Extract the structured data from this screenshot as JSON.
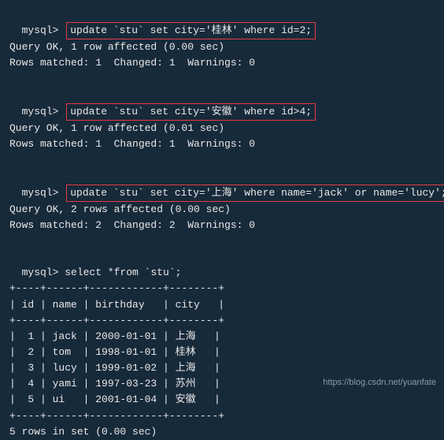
{
  "commands": [
    {
      "prompt": "mysql>",
      "sql": "update `stu` set city='桂林' where id=2;",
      "resultLine": "Query OK, 1 row affected (0.00 sec)",
      "matchLine": "Rows matched: 1  Changed: 1  Warnings: 0"
    },
    {
      "prompt": "mysql>",
      "sql": "update `stu` set city='安徽' where id>4;",
      "resultLine": "Query OK, 1 row affected (0.01 sec)",
      "matchLine": "Rows matched: 1  Changed: 1  Warnings: 0"
    },
    {
      "prompt": "mysql>",
      "sql": "update `stu` set city='上海' where name='jack' or name='lucy';",
      "resultLine": "Query OK, 2 rows affected (0.00 sec)",
      "matchLine": "Rows matched: 2  Changed: 2  Warnings: 0"
    }
  ],
  "selectPrompt": "mysql>",
  "selectSql": " select *from `stu`;",
  "tableBorder": "+----+------+------------+--------+",
  "tableHeader": "| id | name | birthday   | city   |",
  "chart_data": {
    "type": "table",
    "columns": [
      "id",
      "name",
      "birthday",
      "city"
    ],
    "rows": [
      {
        "id": 1,
        "name": "jack",
        "birthday": "2000-01-01",
        "city": "上海"
      },
      {
        "id": 2,
        "name": "tom",
        "birthday": "1998-01-01",
        "city": "桂林"
      },
      {
        "id": 3,
        "name": "lucy",
        "birthday": "1999-01-02",
        "city": "上海"
      },
      {
        "id": 4,
        "name": "yami",
        "birthday": "1997-03-23",
        "city": "苏州"
      },
      {
        "id": 5,
        "name": "ui",
        "birthday": "2001-01-04",
        "city": "安徽"
      }
    ]
  },
  "tableRows": [
    "|  1 | jack | 2000-01-01 | 上海   |",
    "|  2 | tom  | 1998-01-01 | 桂林   |",
    "|  3 | lucy | 1999-01-02 | 上海   |",
    "|  4 | yami | 1997-03-23 | 苏州   |",
    "|  5 | ui   | 2001-01-04 | 安徽   |"
  ],
  "footer": "5 rows in set (0.00 sec)",
  "watermark": "https://blog.csdn.net/yuanfate"
}
